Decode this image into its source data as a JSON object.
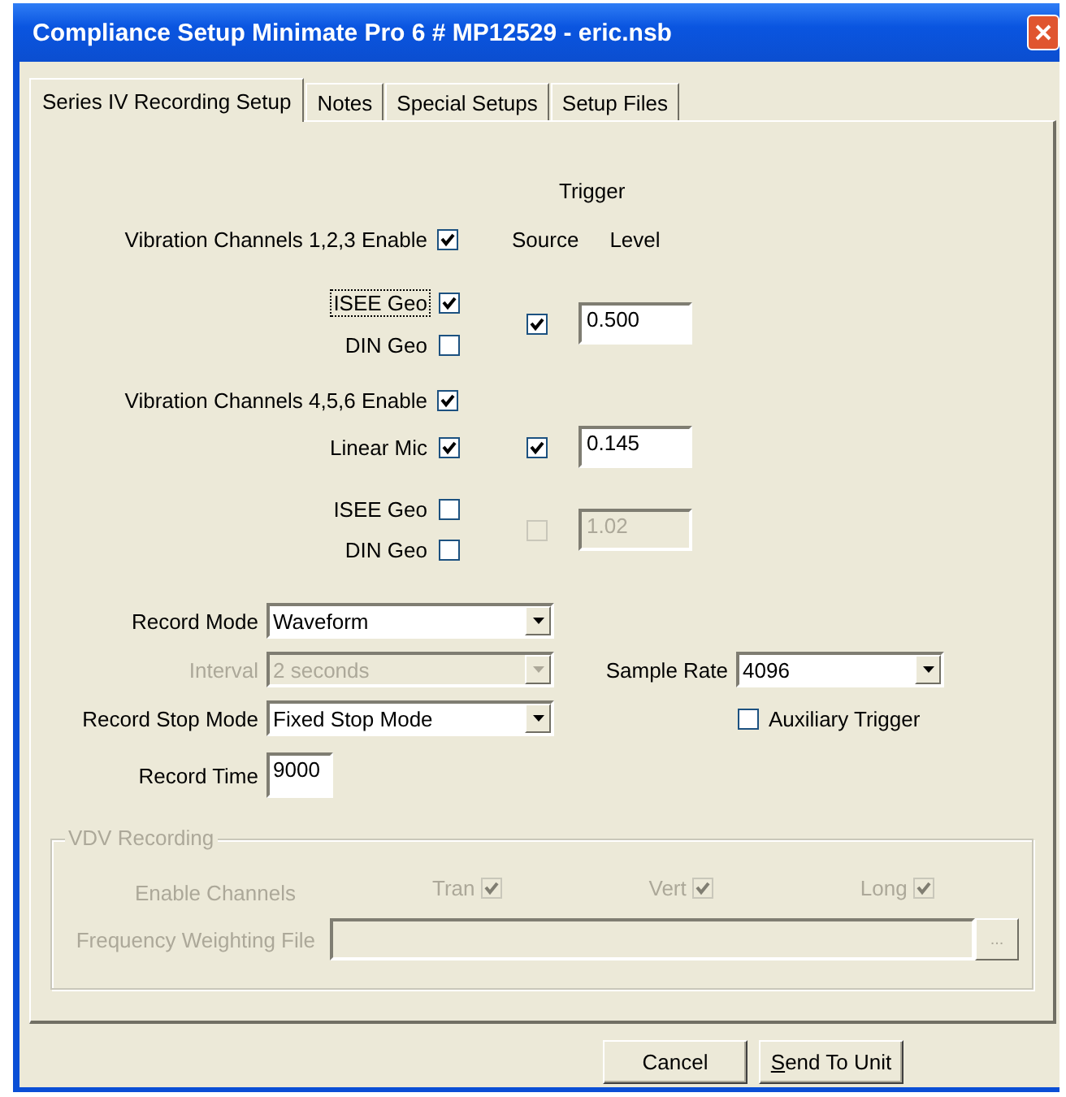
{
  "window": {
    "title": "Compliance Setup Minimate Pro 6 # MP12529 - eric.nsb"
  },
  "tabs": [
    {
      "label": "Series IV Recording Setup",
      "selected": true
    },
    {
      "label": "Notes",
      "selected": false
    },
    {
      "label": "Special Setups",
      "selected": false
    },
    {
      "label": "Setup Files",
      "selected": false
    }
  ],
  "trigger": {
    "heading": "Trigger",
    "source_label": "Source",
    "level_label": "Level"
  },
  "channel_groups": [
    {
      "label": "Vibration Channels 1,2,3 Enable",
      "checked": true,
      "sets": [
        {
          "sensors": [
            {
              "label": "ISEE Geo",
              "checked": true,
              "focused": true
            },
            {
              "label": "DIN Geo",
              "checked": false,
              "focused": false
            }
          ],
          "trigger": {
            "source_checked": true,
            "level_value": "0.500",
            "disabled": false
          }
        }
      ]
    },
    {
      "label": "Vibration Channels 4,5,6 Enable",
      "checked": true,
      "sets": [
        {
          "sensors": [
            {
              "label": "Linear Mic",
              "checked": true,
              "focused": false
            }
          ],
          "trigger": {
            "source_checked": true,
            "level_value": "0.145",
            "disabled": false
          }
        },
        {
          "sensors": [
            {
              "label": "ISEE Geo",
              "checked": false,
              "focused": false
            },
            {
              "label": "DIN Geo",
              "checked": false,
              "focused": false
            }
          ],
          "trigger": {
            "source_checked": false,
            "level_value": "1.02",
            "disabled": true
          }
        }
      ]
    }
  ],
  "record_rows": [
    {
      "left": {
        "kind": "combo",
        "label": "Record Mode",
        "value": "Waveform",
        "disabled": false
      }
    },
    {
      "left": {
        "kind": "combo",
        "label": "Interval",
        "value": "2 seconds",
        "disabled": true
      },
      "right": {
        "kind": "combo",
        "label": "Sample Rate",
        "value": "4096",
        "disabled": false
      }
    },
    {
      "left": {
        "kind": "combo",
        "label": "Record Stop Mode",
        "value": "Fixed Stop Mode",
        "disabled": false
      },
      "right": {
        "kind": "checkbox",
        "label": "Auxiliary Trigger",
        "checked": false
      }
    },
    {
      "left": {
        "kind": "field",
        "label": "Record Time",
        "value": "9000"
      }
    }
  ],
  "vdv": {
    "title": "VDV Recording",
    "disabled": true,
    "enable_label": "Enable Channels",
    "channels": [
      {
        "label": "Tran",
        "checked": true
      },
      {
        "label": "Vert",
        "checked": true
      },
      {
        "label": "Long",
        "checked": true
      }
    ],
    "file_label": "Frequency Weighting File",
    "browse_label": "..."
  },
  "buttons": [
    {
      "label": "Cancel",
      "underline_first": false
    },
    {
      "label": "Send To Unit",
      "underline_first": true
    }
  ]
}
